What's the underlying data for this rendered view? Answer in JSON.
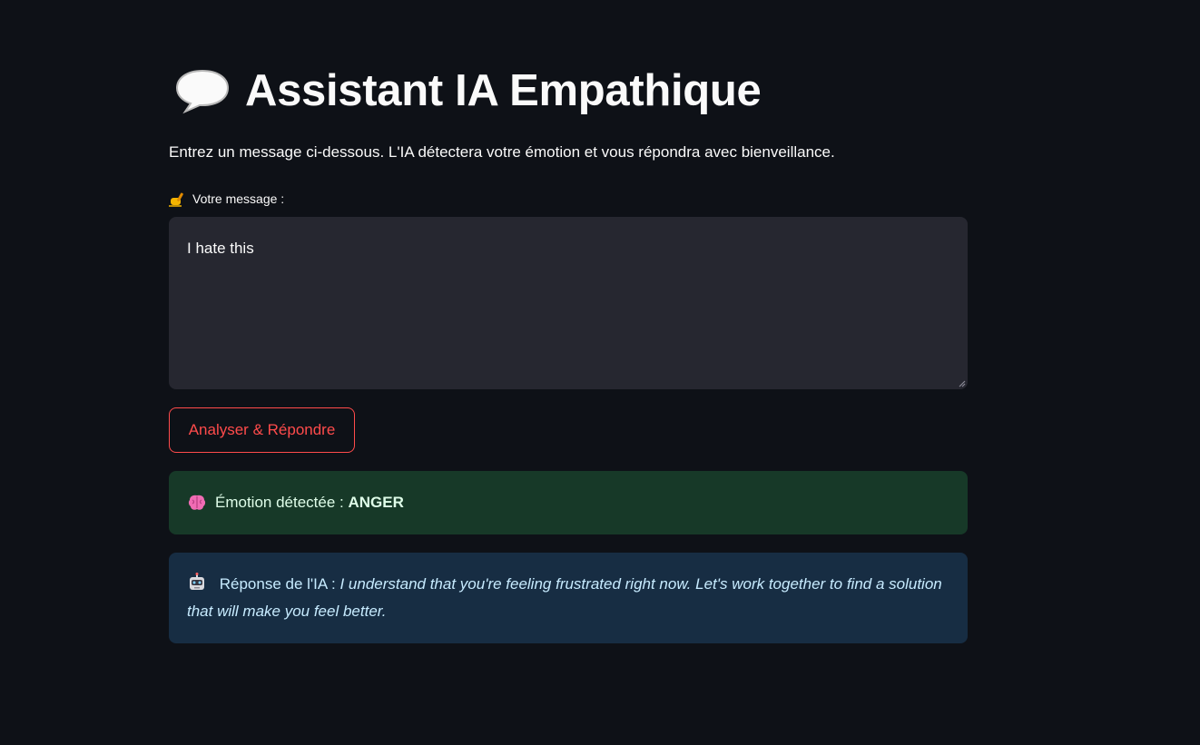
{
  "page": {
    "title": "Assistant IA Empathique",
    "title_icon": "speech-bubble-icon",
    "subtitle": "Entrez un message ci-dessous. L'IA détectera votre émotion et vous répondra avec bienveillance."
  },
  "form": {
    "label": "Votre message :",
    "label_icon": "writing-hand-icon",
    "message_value": "I hate this",
    "submit_label": "Analyser & Répondre"
  },
  "result": {
    "emotion_icon": "brain-icon",
    "emotion_prefix": "Émotion détectée :",
    "emotion_value": "ANGER",
    "response_icon": "robot-icon",
    "response_prefix": "Réponse de l'IA :",
    "response_text": "I understand that you're feeling frustrated right now. Let's work together to find a solution that will make you feel better."
  },
  "colors": {
    "background": "#0e1117",
    "accent": "#ff4b4b",
    "input_bg": "#262730",
    "success_bg": "#173928",
    "info_bg": "#172d43"
  }
}
